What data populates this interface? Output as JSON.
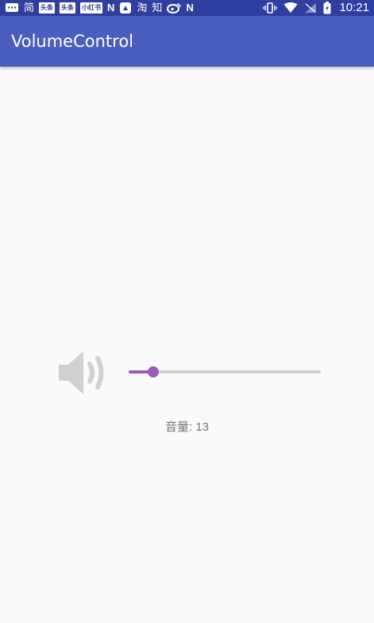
{
  "status_bar": {
    "left_icons": [
      {
        "name": "message-icon",
        "glyph": "…"
      },
      {
        "name": "app-jian-icon",
        "glyph": "简"
      },
      {
        "name": "toutiao-icon",
        "glyph": "头条"
      },
      {
        "name": "toutiao-icon-2",
        "glyph": "头条"
      },
      {
        "name": "xiaohongshu-icon",
        "glyph": "小红书"
      },
      {
        "name": "n-icon",
        "glyph": "N"
      },
      {
        "name": "lock-app-icon",
        "glyph": "▲"
      },
      {
        "name": "taobao-icon",
        "glyph": "淘"
      },
      {
        "name": "zhihu-icon",
        "glyph": "知"
      },
      {
        "name": "weibo-icon",
        "glyph": "◉"
      },
      {
        "name": "n-icon-2",
        "glyph": "N"
      }
    ],
    "time": "10:21"
  },
  "app_bar": {
    "title": "VolumeControl"
  },
  "volume": {
    "label": "音量: 13",
    "level_fraction": 0.13
  },
  "colors": {
    "status_bar": "#303f9f",
    "app_bar": "#4a5fbd",
    "accent": "#9c5cb4",
    "speaker": "#d0d0d0",
    "track": "#cfcfcf"
  }
}
